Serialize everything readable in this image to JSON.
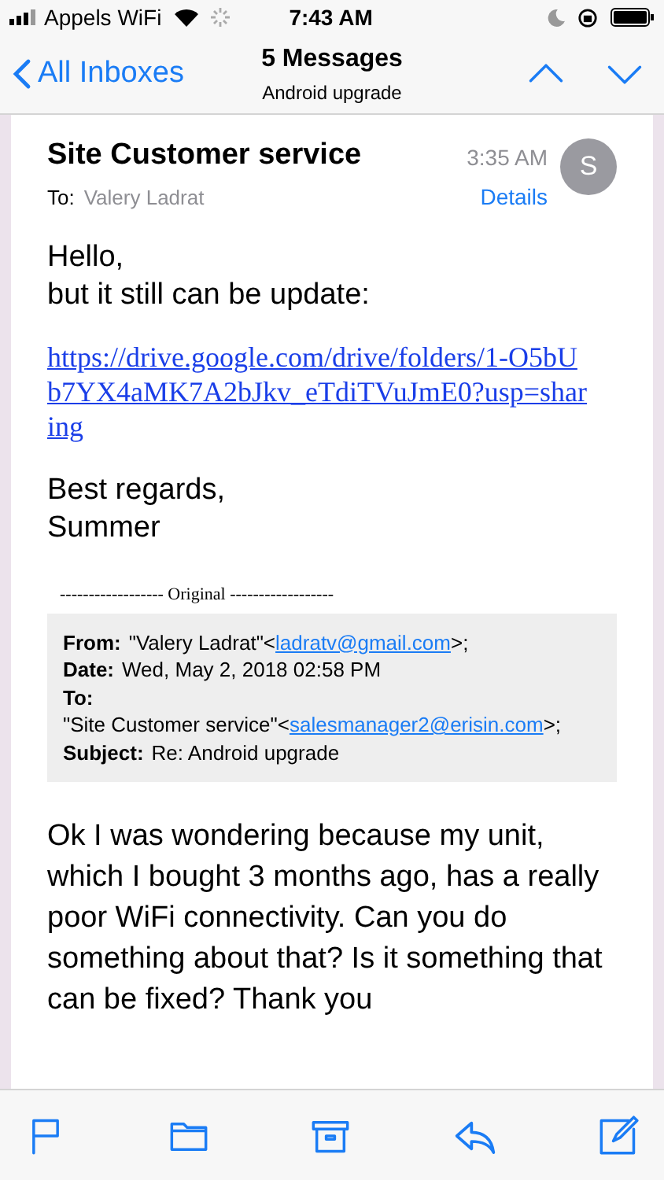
{
  "status_bar": {
    "carrier": "Appels WiFi",
    "time": "7:43 AM"
  },
  "nav": {
    "back": "All Inboxes",
    "title": "5 Messages",
    "subtitle": "Android upgrade"
  },
  "message": {
    "sender": "Site Customer service",
    "to_label": "To:",
    "to": "Valery Ladrat",
    "time": "3:35 AM",
    "details": "Details",
    "avatar": "S"
  },
  "body": {
    "greeting": [
      "Hello,",
      "but it still can be update:"
    ],
    "link": "https://drive.google.com/drive/folders/1-O5bUb7YX4aMK7A2bJkv_eTdiTVuJmE0?usp=sharing",
    "signoff": [
      "Best regards,",
      "Summer"
    ],
    "original_divider": "------------------ Original ------------------"
  },
  "quoted": [
    {
      "label": "From:",
      "text": "\"Valery Ladrat\"<",
      "link": "ladratv@gmail.com",
      "tail": ">;"
    },
    {
      "label": "Date:",
      "text": "Wed, May 2, 2018 02:58 PM"
    },
    {
      "label": "To:"
    },
    {
      "text": "\"Site Customer service\"<",
      "link": "salesmanager2@erisin.com",
      "tail": ">;"
    },
    {
      "label": "Subject:",
      "text": "Re: Android upgrade"
    }
  ],
  "reply": "Ok I was wondering because my unit, which I bought 3 months ago, has a really poor WiFi connectivity. Can you do something about that? Is it something that can be fixed? Thank you"
}
